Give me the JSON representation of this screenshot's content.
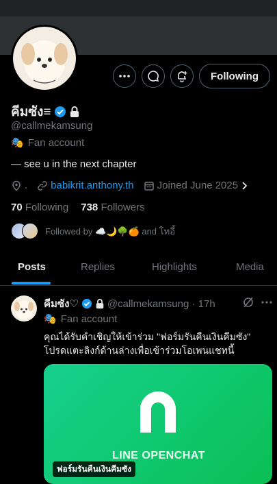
{
  "profile": {
    "name": "คีมซัง≡",
    "handle": "@callmekamsung",
    "category": "Fan account",
    "bio": "— see u in the next chapter",
    "location": ".",
    "website": "babikrit.anthony.th",
    "joined": "Joined June 2025",
    "following_count": "70",
    "following_label": "Following",
    "followers_count": "738",
    "followers_label": "Followers",
    "followed_by": "Followed by ☁️🌙🌳🍊 and โทอี้"
  },
  "actions": {
    "follow_label": "Following"
  },
  "tabs": [
    "Posts",
    "Replies",
    "Highlights",
    "Media"
  ],
  "post": {
    "name": "คีมซัง♡",
    "handle": "@callmekamsung · 17h",
    "category": "Fan account",
    "text_line1": "คุณได้รับคำเชิญให้เข้าร่วม \"ฟอร์มรันคืนเงินคีมซัง\"",
    "text_line2": "โปรดแตะลิงก์ด้านล่างเพื่อเข้าร่วมโอเพนแชทนี้",
    "card_label": "ฟอร์มรันคืนเงินคีมซัง",
    "card_brand": "LINE OPENCHAT"
  },
  "colors": {
    "accent": "#1d9bf0",
    "line_green": "#0fc76b"
  }
}
